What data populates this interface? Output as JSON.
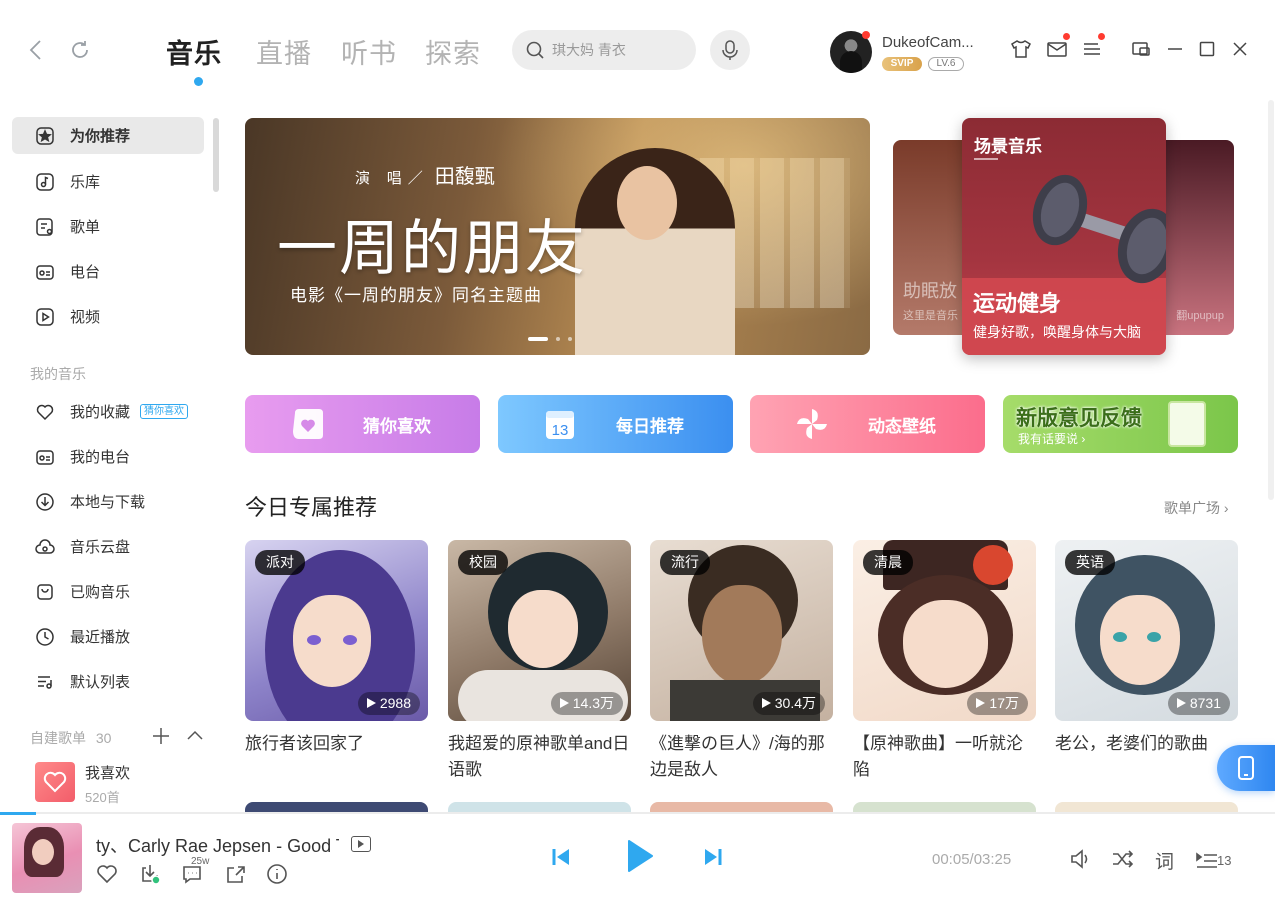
{
  "header": {
    "tabs": [
      {
        "label": "音乐",
        "active": true
      },
      {
        "label": "直播",
        "active": false
      },
      {
        "label": "听书",
        "active": false
      },
      {
        "label": "探索",
        "active": false
      }
    ],
    "search_placeholder": "琪大妈 青衣",
    "user": {
      "name": "DukeofCam...",
      "vip_badge": "SVIP",
      "level_badge": "LV.6"
    }
  },
  "sidebar": {
    "nav": [
      {
        "label": "为你推荐",
        "icon": "star-icon",
        "active": true
      },
      {
        "label": "乐库",
        "icon": "music-note-icon"
      },
      {
        "label": "歌单",
        "icon": "playlist-icon"
      },
      {
        "label": "电台",
        "icon": "radio-icon"
      },
      {
        "label": "视频",
        "icon": "video-icon"
      }
    ],
    "my_music_title": "我的音乐",
    "my_music": [
      {
        "label": "我的收藏",
        "icon": "heart-icon",
        "tag": "猜你喜欢"
      },
      {
        "label": "我的电台",
        "icon": "radio-icon"
      },
      {
        "label": "本地与下载",
        "icon": "download-icon"
      },
      {
        "label": "音乐云盘",
        "icon": "cloud-icon"
      },
      {
        "label": "已购音乐",
        "icon": "bag-icon"
      },
      {
        "label": "最近播放",
        "icon": "clock-icon"
      },
      {
        "label": "默认列表",
        "icon": "list-icon"
      }
    ],
    "custom_playlists_title": "自建歌单",
    "custom_playlists_count": "30",
    "playlist": {
      "title": "我喜欢",
      "count": "520首"
    }
  },
  "banner": {
    "singer_prefix": "演 唱／",
    "singer": "田馥甄",
    "title": "一周的朋友",
    "subtitle": "电影《一周的朋友》同名主题曲",
    "dots": 3,
    "active_dot": 0
  },
  "scene": {
    "label": "场景音乐",
    "title": "运动健身",
    "desc": "健身好歌，唤醒身体与大脑",
    "left_card_title": "助眠放",
    "left_card_desc": "这里是音乐",
    "right_card_desc": "翻upupup"
  },
  "quick_entries": [
    {
      "label": "猜你喜欢",
      "icon": "heart-bag-icon"
    },
    {
      "label": "每日推荐",
      "icon": "calendar-icon",
      "date": "13"
    },
    {
      "label": "动态壁纸",
      "icon": "pinwheel-icon"
    },
    {
      "label": "新版意见反馈",
      "sub": "我有话要说 ›",
      "icon": "feedback-paper-icon"
    }
  ],
  "section": {
    "title": "今日专属推荐",
    "link": "歌单广场 ›"
  },
  "cards": [
    {
      "tag": "派对",
      "plays": "2988",
      "title": "旅行者该回家了"
    },
    {
      "tag": "校园",
      "plays": "14.3万",
      "title": "我超爱的原神歌单and日语歌"
    },
    {
      "tag": "流行",
      "plays": "30.4万",
      "title": "《進撃の巨人》/海的那边是敌人"
    },
    {
      "tag": "清晨",
      "plays": "17万",
      "title": "【原神歌曲】一听就沦陷"
    },
    {
      "tag": "英语",
      "plays": "8731",
      "title": "老公，老婆们的歌曲"
    }
  ],
  "player": {
    "song": "ty、Carly Rae Jepsen - Good T",
    "comment_count": "25w",
    "time": "00:05/03:25",
    "lyric_label": "词",
    "queue_count": "13",
    "progress": 0.028
  },
  "colors": {
    "accent": "#2fa8ef",
    "active_bg": "#e9e9e9"
  }
}
